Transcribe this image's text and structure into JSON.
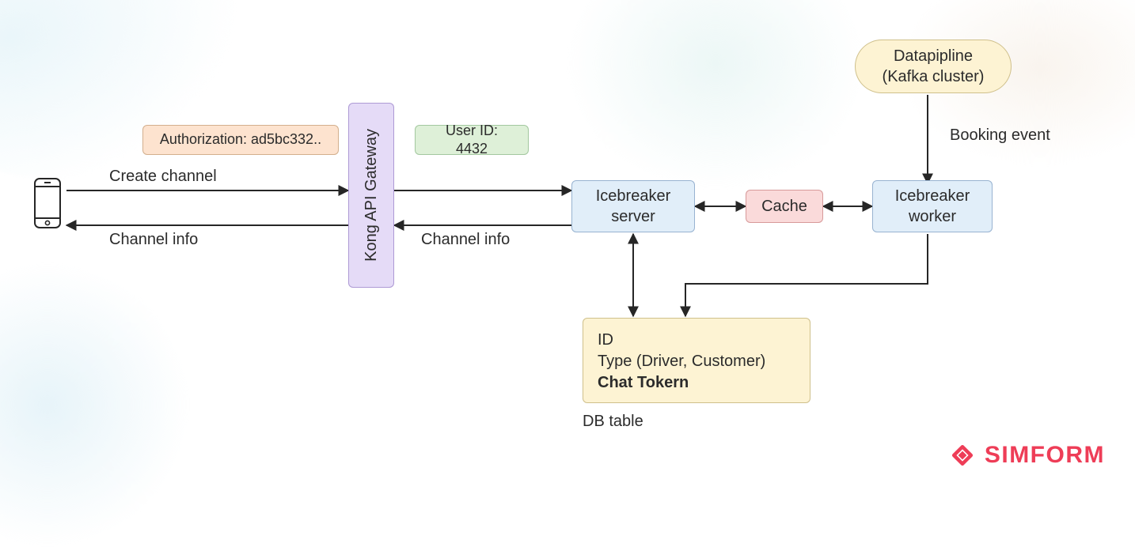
{
  "phone": {
    "name": "mobile-device"
  },
  "auth_box": {
    "label": "Authorization: ad5bc332.."
  },
  "user_box": {
    "label": "User ID: 4432"
  },
  "gateway": {
    "label": "Kong API Gateway"
  },
  "icebreaker_server": {
    "line1": "Icebreaker",
    "line2": "server"
  },
  "cache": {
    "label": "Cache"
  },
  "icebreaker_worker": {
    "line1": "Icebreaker",
    "line2": "worker"
  },
  "datapipeline": {
    "line1": "Datapipline",
    "line2": "(Kafka cluster)"
  },
  "db_table": {
    "line1": "ID",
    "line2": "Type (Driver, Customer)",
    "line3": "Chat Tokern",
    "caption": "DB table"
  },
  "edges": {
    "create_channel": "Create channel",
    "channel_info_left": "Channel info",
    "channel_info_right": "Channel info",
    "booking_event": "Booking event"
  },
  "brand": {
    "name": "SIMFORM"
  },
  "colors": {
    "orange": "#fde3cf",
    "green": "#def0d8",
    "purple": "#e5dbf7",
    "blue": "#e1eef9",
    "pink": "#fadada",
    "yellow": "#fdf3d3",
    "brand": "#ee3d57",
    "arrow": "#262626"
  }
}
